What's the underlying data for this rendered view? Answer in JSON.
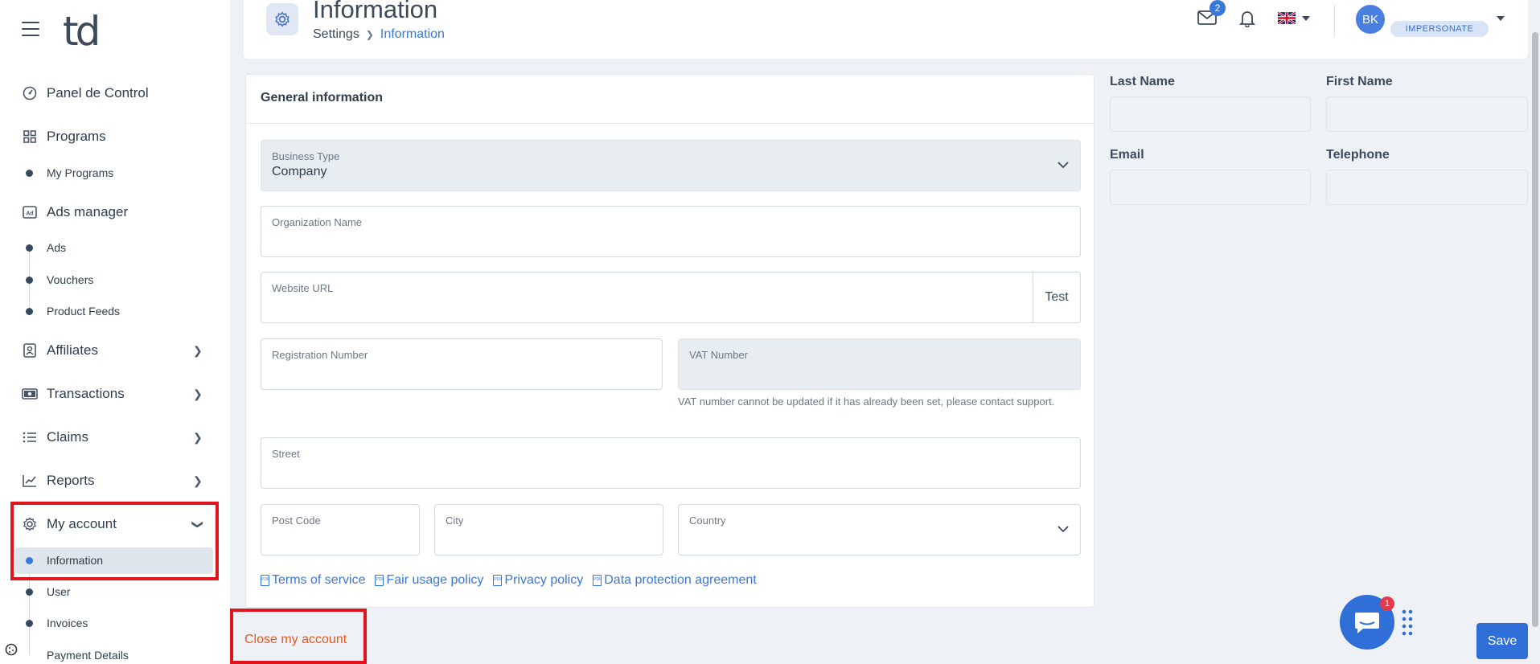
{
  "sidebar": {
    "logo": "td",
    "items": [
      {
        "label": "Panel de Control",
        "icon": "dashboard-icon"
      },
      {
        "label": "Programs",
        "icon": "grid-icon"
      },
      {
        "label": "My Programs"
      },
      {
        "label": "Ads manager",
        "icon": "ad-icon"
      },
      {
        "label": "Ads"
      },
      {
        "label": "Vouchers"
      },
      {
        "label": "Product Feeds"
      },
      {
        "label": "Affiliates",
        "icon": "user-card-icon"
      },
      {
        "label": "Transactions",
        "icon": "money-icon"
      },
      {
        "label": "Claims",
        "icon": "list-icon"
      },
      {
        "label": "Reports",
        "icon": "chart-icon"
      },
      {
        "label": "My account",
        "icon": "gear-icon"
      },
      {
        "label": "Information"
      },
      {
        "label": "User"
      },
      {
        "label": "Invoices"
      },
      {
        "label": "Payment Details"
      }
    ]
  },
  "header": {
    "title": "Information",
    "breadcrumb": [
      "Settings",
      "Information"
    ],
    "mail_count": "2",
    "avatar": "BK",
    "impersonate": "IMPERSONATE"
  },
  "card": {
    "title": "General information",
    "business_type_label": "Business Type",
    "business_type_value": "Company",
    "organization_label": "Organization Name",
    "website_label": "Website URL",
    "test_label": "Test",
    "registration_label": "Registration Number",
    "vat_label": "VAT Number",
    "vat_note": "VAT number cannot be updated if it has already been set, please contact support.",
    "street_label": "Street",
    "postcode_label": "Post Code",
    "city_label": "City",
    "country_label": "Country",
    "links": [
      "Terms of service",
      "Fair usage policy",
      "Privacy policy",
      "Data protection agreement"
    ]
  },
  "right_panel": {
    "last_name": "Last Name",
    "first_name": "First Name",
    "email": "Email",
    "telephone": "Telephone"
  },
  "footer": {
    "close_account": "Close my account",
    "save": "Save",
    "chat_badge": "1"
  },
  "colors": {
    "accent": "#2f6fd7",
    "highlight_box": "#e0141b",
    "close_link": "#e8581c"
  }
}
